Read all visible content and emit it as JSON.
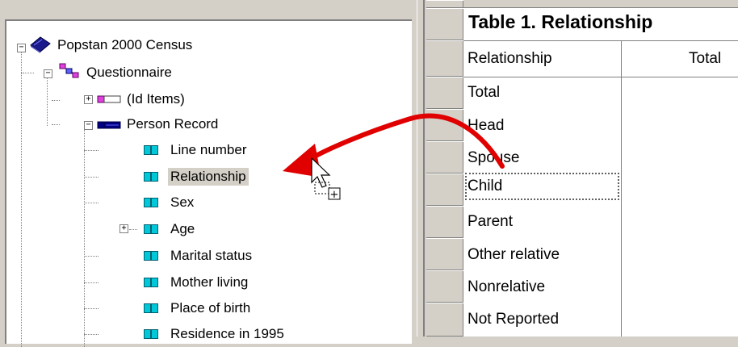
{
  "tree": {
    "root_label": "Popstan 2000 Census",
    "questionnaire_label": "Questionnaire",
    "id_items_label": "(Id Items)",
    "person_record_label": "Person Record",
    "items": [
      {
        "label": "Line number"
      },
      {
        "label": "Relationship",
        "selected": true
      },
      {
        "label": "Sex"
      },
      {
        "label": "Age",
        "expandable": true
      },
      {
        "label": "Marital status"
      },
      {
        "label": "Mother living"
      },
      {
        "label": "Place of birth"
      },
      {
        "label": "Residence in 1995"
      }
    ],
    "expander_plus": "+",
    "expander_minus": "−"
  },
  "table": {
    "title": "Table 1. Relationship",
    "column_headers": [
      "Relationship",
      "Total"
    ],
    "rows": [
      "Total",
      "Head",
      "Spouse",
      "Child",
      "Parent",
      "Other relative",
      "Nonrelative",
      "Not Reported"
    ],
    "focused_row": "Child"
  },
  "drag": {
    "arrow_color": "#e00000",
    "cursor_badge": "+"
  },
  "colors": {
    "window_bg": "#d4d0c8",
    "item_icon": "#00c8d8",
    "book_icon": "#1a1a8c",
    "questionnaire_icon": "#e040e0",
    "record_icon": "#000080"
  }
}
